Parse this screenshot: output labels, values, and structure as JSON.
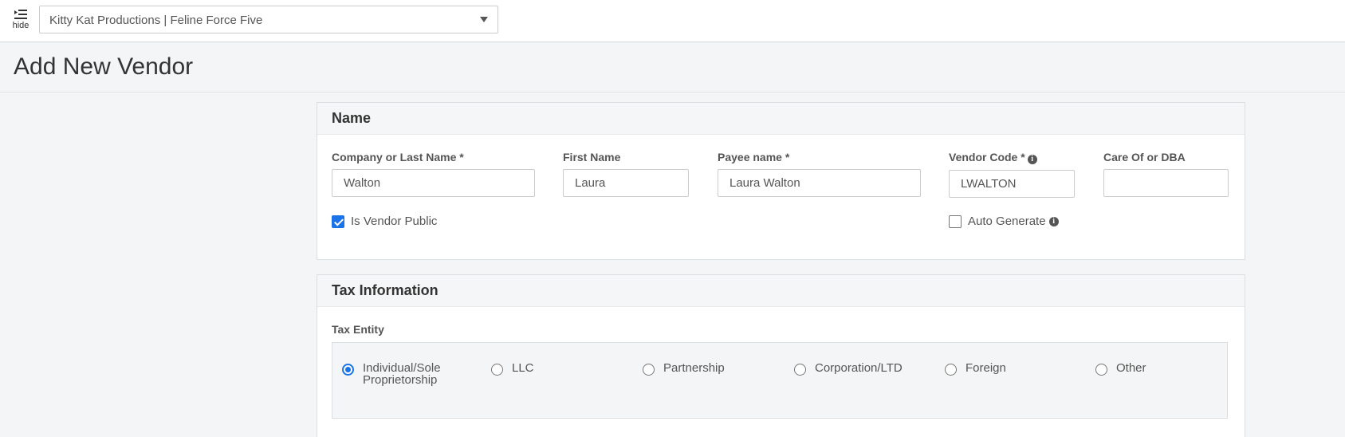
{
  "topbar": {
    "hide_label": "hide",
    "project_select": "Kitty Kat Productions | Feline Force Five"
  },
  "page": {
    "title": "Add New Vendor"
  },
  "name_panel": {
    "heading": "Name",
    "company_label": "Company or Last Name *",
    "company_value": "Walton",
    "first_label": "First Name",
    "first_value": "Laura",
    "payee_label": "Payee name *",
    "payee_value": "Laura Walton",
    "vendor_code_label": "Vendor Code *",
    "vendor_code_value": "LWALTON",
    "care_of_label": "Care Of or DBA",
    "care_of_value": "",
    "is_public_label": "Is Vendor Public",
    "is_public_checked": true,
    "auto_generate_label": "Auto Generate",
    "auto_generate_checked": false
  },
  "tax_panel": {
    "heading": "Tax Information",
    "entity_label": "Tax Entity",
    "options": [
      {
        "label_line1": "Individual/Sole",
        "label_line2": "Proprietorship",
        "selected": true
      },
      {
        "label_line1": "LLC",
        "label_line2": "",
        "selected": false
      },
      {
        "label_line1": "Partnership",
        "label_line2": "",
        "selected": false
      },
      {
        "label_line1": "Corporation/LTD",
        "label_line2": "",
        "selected": false
      },
      {
        "label_line1": "Foreign",
        "label_line2": "",
        "selected": false
      },
      {
        "label_line1": "Other",
        "label_line2": "",
        "selected": false
      }
    ]
  },
  "colors": {
    "accent": "#1a73e8",
    "panel_bg": "#f5f6f7",
    "page_bg": "#f4f5f6"
  },
  "icons": [
    "list-collapse-icon",
    "chevron-down-icon",
    "info-icon",
    "checkbox-icon",
    "radio-icon"
  ]
}
